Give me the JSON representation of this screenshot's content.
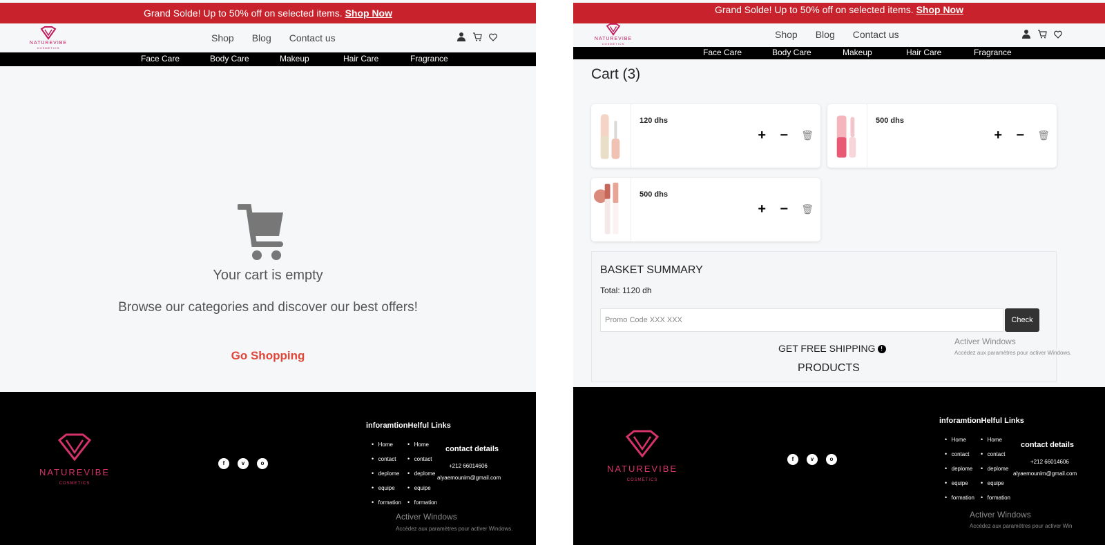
{
  "promo": {
    "text": "Grand Solde! Up to 50% off on selected items.",
    "link": "Shop Now"
  },
  "brand": {
    "name": "NATUREVIBE",
    "tagline": "COSMETICS"
  },
  "nav": [
    "Shop",
    "Blog",
    "Contact us"
  ],
  "categories": [
    "Face Care",
    "Body Care",
    "Makeup",
    "Hair Care",
    "Fragrance"
  ],
  "empty_cart": {
    "title": "Your cart is empty",
    "subtitle": "Browse our categories and discover our best offers!",
    "cta": "Go Shopping"
  },
  "cart": {
    "title": "Cart (3)",
    "items": [
      {
        "price": "120 dhs",
        "image": "lip-product-beige"
      },
      {
        "price": "500 dhs",
        "image": "lip-gloss-pink"
      },
      {
        "price": "500 dhs",
        "image": "lip-products-set"
      }
    ],
    "plus_symbol": "+",
    "minus_symbol": "−",
    "trash_symbol": "🗑"
  },
  "summary": {
    "title": "BASKET SUMMARY",
    "total": "Total: 1120 dh",
    "promo_placeholder": "Promo Code XXX XXX",
    "check_label": "Check",
    "free_shipping": "GET FREE SHIPPING",
    "products_label": "PRODUCTS"
  },
  "footer": {
    "links_title": "inforamtionHelful Links",
    "links": [
      "Home",
      "contact",
      "deplome",
      "equipe",
      "formation"
    ],
    "contact_title": "contact details",
    "phone": "+212 66014606",
    "email": "alyaemounim@gmail.com",
    "socials": [
      "facebook-icon",
      "twitter-icon",
      "instagram-icon"
    ],
    "social_glyphs": [
      "f",
      "v",
      "o"
    ]
  },
  "watermark": {
    "title": "Activer Windows",
    "left_sub": "Accédez aux paramètres pour activer Windows.",
    "right_sub_top": "Accédez aux paramètres pour activer Windows.",
    "right_sub_bottom": "Accédez aux paramètres pour activer Win"
  },
  "colors": {
    "promo_red": "#c8232c",
    "brand_pink": "#d6336c",
    "cta_red": "#e0463a"
  }
}
